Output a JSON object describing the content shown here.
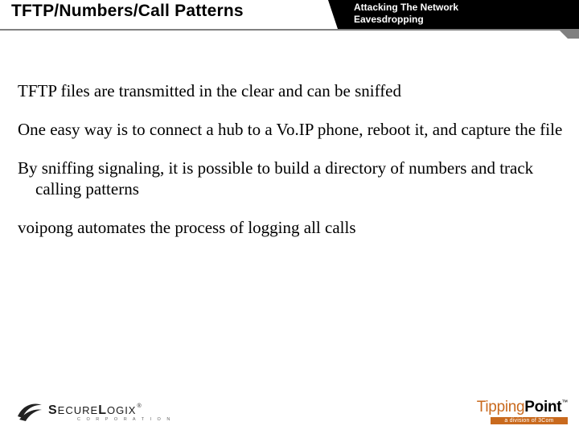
{
  "header": {
    "title": "TFTP/Numbers/Call Patterns",
    "tab_line1": "Attacking The Network",
    "tab_line2": "Eavesdropping"
  },
  "body": {
    "p1": "TFTP files are transmitted in the clear and can be sniffed",
    "p2": "One easy way is to connect a hub to a Vo.IP phone, reboot it, and capture the file",
    "p3": "By sniffing signaling, it is possible to build a directory of numbers and track calling patterns",
    "p4": "voipong automates the process of logging all calls"
  },
  "footer": {
    "left_brand_1": "S",
    "left_brand_2": "ECURE",
    "left_brand_3": "L",
    "left_brand_4": "OGIX",
    "left_reg": "®",
    "left_sub": "C O R P O R A T I O N",
    "right_brand_1": "Tipping",
    "right_brand_2": "Point",
    "right_tm": "™",
    "right_sub": "a division of 3Com"
  }
}
